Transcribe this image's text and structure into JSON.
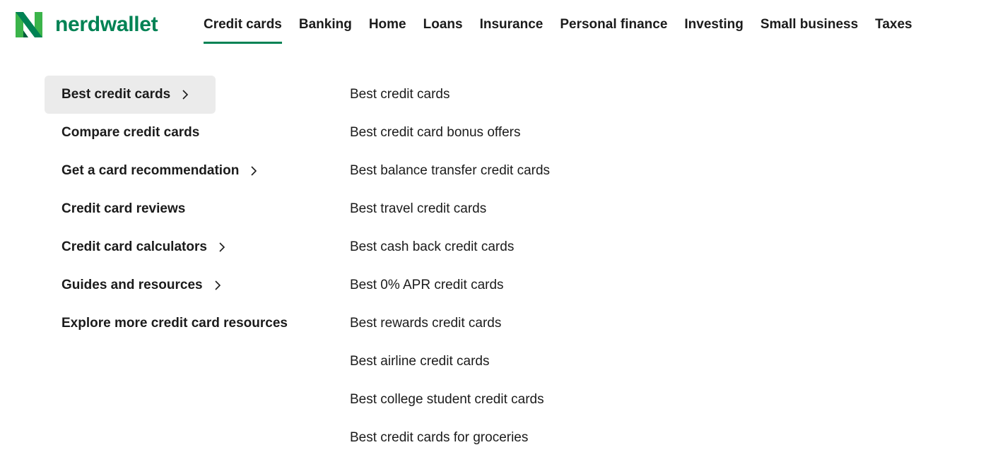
{
  "brand": {
    "name": "nerdwallet",
    "logo_icon": "nerdwallet-n-logo-icon",
    "colors": {
      "primary_green": "#008254",
      "light_green": "#3bb44a",
      "dark_green": "#005d3c",
      "active_bg": "#ebebeb",
      "text": "#1b1b1b"
    }
  },
  "nav": {
    "items": [
      {
        "label": "Credit cards",
        "active": true
      },
      {
        "label": "Banking",
        "active": false
      },
      {
        "label": "Home",
        "active": false
      },
      {
        "label": "Loans",
        "active": false
      },
      {
        "label": "Insurance",
        "active": false
      },
      {
        "label": "Personal finance",
        "active": false
      },
      {
        "label": "Investing",
        "active": false
      },
      {
        "label": "Small business",
        "active": false
      },
      {
        "label": "Taxes",
        "active": false
      }
    ]
  },
  "left_menu": {
    "items": [
      {
        "label": "Best credit cards",
        "has_submenu": true,
        "active": true
      },
      {
        "label": "Compare credit cards",
        "has_submenu": false,
        "active": false
      },
      {
        "label": "Get a card recommendation",
        "has_submenu": true,
        "active": false
      },
      {
        "label": "Credit card reviews",
        "has_submenu": false,
        "active": false
      },
      {
        "label": "Credit card calculators",
        "has_submenu": true,
        "active": false
      },
      {
        "label": "Guides and resources",
        "has_submenu": true,
        "active": false
      },
      {
        "label": "Explore more credit card resources",
        "has_submenu": false,
        "active": false
      }
    ]
  },
  "right_menu": {
    "items": [
      {
        "label": "Best credit cards"
      },
      {
        "label": "Best credit card bonus offers"
      },
      {
        "label": "Best balance transfer credit cards"
      },
      {
        "label": "Best travel credit cards"
      },
      {
        "label": "Best cash back credit cards"
      },
      {
        "label": "Best 0% APR credit cards"
      },
      {
        "label": "Best rewards credit cards"
      },
      {
        "label": "Best airline credit cards"
      },
      {
        "label": "Best college student credit cards"
      },
      {
        "label": "Best credit cards for groceries"
      }
    ]
  }
}
